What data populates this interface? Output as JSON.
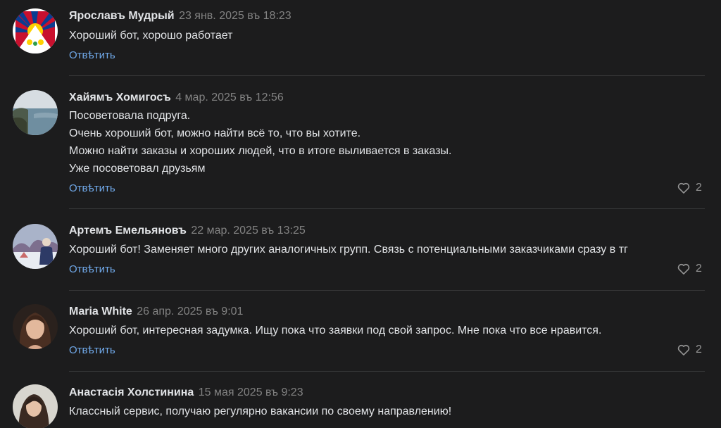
{
  "reply_label": "Отвѣтить",
  "colors": {
    "background": "#1c1c1d",
    "text": "#e1e3e6",
    "date": "#828282",
    "link": "#71aaeb",
    "divider": "#363738"
  },
  "comments": [
    {
      "author": "Ярославъ Мудрый",
      "date": "23 янв. 2025 въ 18:23",
      "lines": [
        "Хороший бот, хорошо работает"
      ],
      "likes": null,
      "avatar": "flag-avatar"
    },
    {
      "author": "Хайямъ Хомигосъ",
      "date": "4 мар. 2025 въ 12:56",
      "lines": [
        "Посоветовала подруга.",
        "Очень хороший бот, можно найти всё то, что вы хотите.",
        "Можно найти заказы и хороших людей, что в итоге выливается в заказы.",
        "Уже посоветовал друзьям"
      ],
      "likes": "2",
      "avatar": "coast-avatar"
    },
    {
      "author": "Артемъ Емельяновъ",
      "date": "22 мар. 2025 въ 13:25",
      "lines": [
        "Хороший бот! Заменяет много других аналогичных групп. Связь с потенциальными заказчиками сразу в тг"
      ],
      "likes": "2",
      "avatar": "winter-avatar"
    },
    {
      "author": "Maria White",
      "date": "26 апр. 2025 въ 9:01",
      "lines": [
        "Хороший бот, интересная задумка. Ищу пока что заявки под свой запрос. Мне пока что все нравится."
      ],
      "likes": "2",
      "avatar": "portrait-avatar"
    },
    {
      "author": "Анастасія Холстинина",
      "date": "15 мая 2025 въ 9:23",
      "lines": [
        "Классный сервис, получаю регулярно вакансии по своему направлению!"
      ],
      "likes": null,
      "avatar": "portrait-avatar-2"
    }
  ]
}
